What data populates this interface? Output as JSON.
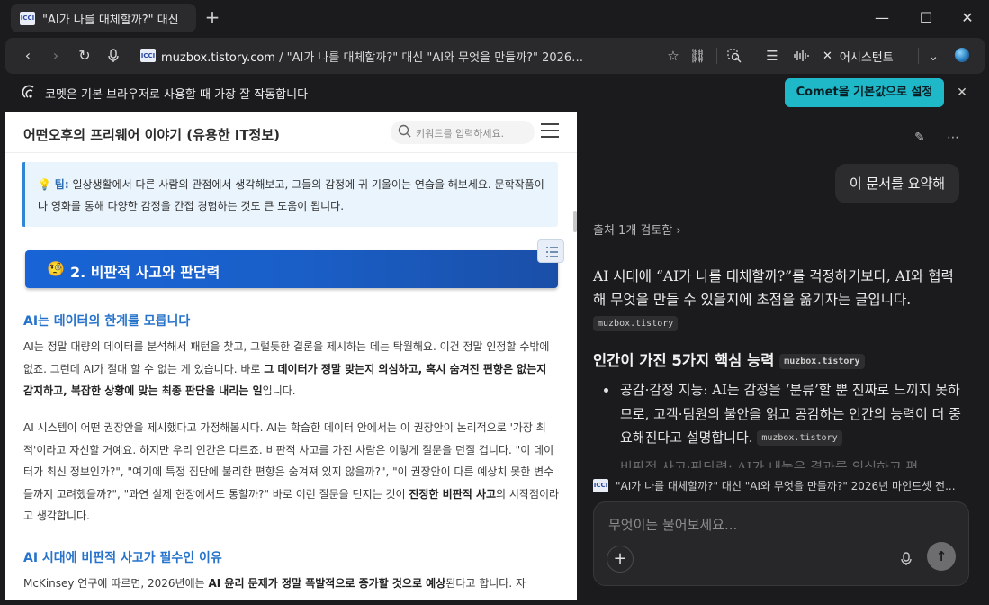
{
  "tab": {
    "title": "\"AI가 나를 대체할까?\" 대신",
    "favicon_text": "ICCI"
  },
  "window": {
    "minimize": "—",
    "maximize": "☐",
    "close": "✕"
  },
  "address": {
    "domain": "muzbox.tistory.com",
    "path": " / \"AI가 나를 대체할까?\" 대신 \"AI와 무엇을 만들까?\" 2026…"
  },
  "toolbar": {
    "assistant_label": "어시스턴트"
  },
  "notice": {
    "text": "코멧은 기본 브라우저로 사용할 때 가장 잘 작동합니다",
    "button": "Comet을 기본값으로 설정"
  },
  "page": {
    "site_title": "어떤오후의 프리웨어 이야기 (유용한 IT정보)",
    "search_placeholder": "키워드를 입력하세요.",
    "tip_label": "팁:",
    "tip_text": " 일상생활에서 다른 사람의 관점에서 생각해보고, 그들의 감정에 귀 기울이는 연습을 해보세요. 문학작품이나 영화를 통해 다양한 감정을 간접 경험하는 것도 큰 도움이 됩니다.",
    "section_title": "2. 비판적 사고와 판단력",
    "h3_1": "AI는 데이터의 한계를 모릅니다",
    "p1_a": "AI는 정말 대량의 데이터를 분석해서 패턴을 찾고, 그럴듯한 결론을 제시하는 데는 탁월해요. 이건 정말 인정할 수밖에 없죠. 그런데 AI가 절대 할 수 없는 게 있습니다. 바로 ",
    "p1_b": "그 데이터가 정말 맞는지 의심하고, 혹시 숨겨진 편향은 없는지 감지하고, 복잡한 상황에 맞는 최종 판단을 내리는 일",
    "p1_c": "입니다.",
    "p2_a": "AI 시스템이 어떤 권장안을 제시했다고 가정해봅시다. AI는 학습한 데이터 안에서는 이 권장안이 논리적으로 '가장 최적'이라고 자신할 거예요. 하지만 우리 인간은 다르죠. 비판적 사고를 가진 사람은 이렇게 질문을 던질 겁니다. \"이 데이터가 최신 정보인가?\", \"여기에 특정 집단에 불리한 편향은 숨겨져 있지 않을까?\", \"이 권장안이 다른 예상치 못한 변수들까지 고려했을까?\", \"과연 실제 현장에서도 통할까?\" 바로 이런 질문을 던지는 것이 ",
    "p2_b": "진정한 비판적 사고",
    "p2_c": "의 시작점이라고 생각합니다.",
    "h3_2": "AI 시대에 비판적 사고가 필수인 이유",
    "p3_a": "McKinsey 연구에 따르면, 2026년에는 ",
    "p3_b": "AI 윤리 문제가 정말 폭발적으로 증가할 것으로 예상",
    "p3_c": "된다고 합니다. 자"
  },
  "assistant": {
    "user_message": "이 문서를 요약해",
    "sources": "출처 1개 검토함 ›",
    "answer_1": "AI 시대에 “AI가 나를 대체할까?”를 걱정하기보다, AI와 협력해 무엇을 만들 수 있을지에 초점을 옮기자는 글입니다. ",
    "cite": "muzbox.tistory",
    "heading": "인간이 가진 5가지 핵심 능력",
    "bullet_1": "공감·감정 지능: AI는 감정을 ‘분류’할 뿐 진짜로 느끼지 못하므로, 고객·팀원의 불안을 읽고 공감하는 인간의 능력이 더 중요해진다고 설명합니다. ",
    "bullet_2_partial": "비판적 사고·판단력: AI가 내놓은 결과를 의심하고 편",
    "context_title": "\"AI가 나를 대체할까?\" 대신 \"AI와 무엇을 만들까?\" 2026년 마인드셋 전...",
    "composer_placeholder": "무엇이든 물어보세요..."
  },
  "colors": {
    "accent": "#1fb8c9",
    "banner_blue": "#1a5fc8",
    "heading_blue": "#2673cc"
  }
}
